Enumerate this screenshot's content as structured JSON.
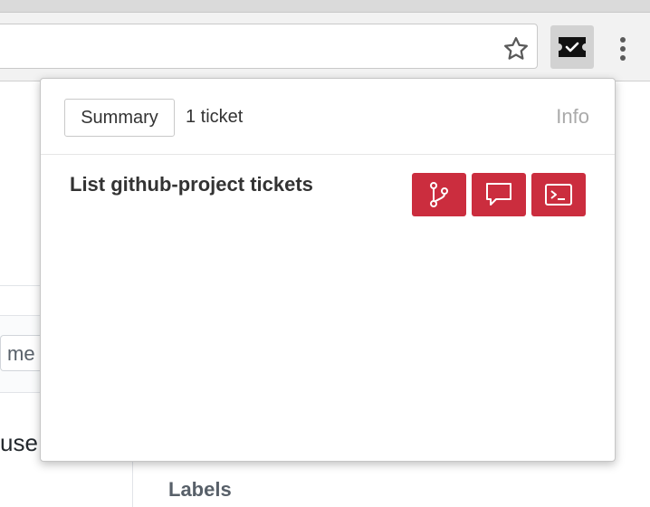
{
  "browser": {
    "star_icon": "star-outline-icon",
    "extension_icon": "ticket-check-icon",
    "menu_icon": "vertical-dots-icon"
  },
  "page": {
    "search_fragment": "me",
    "text_fragment": "use",
    "labels_heading": "Labels"
  },
  "popup": {
    "summary_label": "Summary",
    "ticket_count": "1 ticket",
    "info_label": "Info",
    "tickets": [
      {
        "title": "List github-project tickets",
        "actions": [
          "git-branch-icon",
          "comment-icon",
          "terminal-icon"
        ]
      }
    ],
    "accent_color": "#cb2d3e"
  }
}
